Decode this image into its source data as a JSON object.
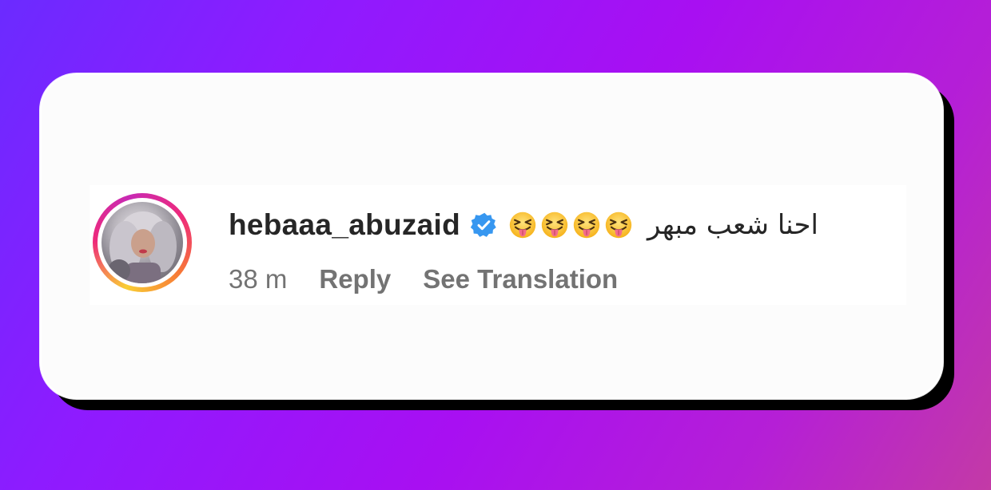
{
  "comment": {
    "username": "hebaaa_abuzaid",
    "verified": true,
    "emoji_count": 4,
    "emoji_name": "squinting-face-with-tongue-icon",
    "text": "احنا شعب مبهر",
    "timestamp": "38 m",
    "reply_label": "Reply",
    "translate_label": "See Translation"
  },
  "colors": {
    "verified_badge": "#3797f0",
    "username": "#262626",
    "meta": "#737373",
    "card": "#fcfcfc"
  }
}
